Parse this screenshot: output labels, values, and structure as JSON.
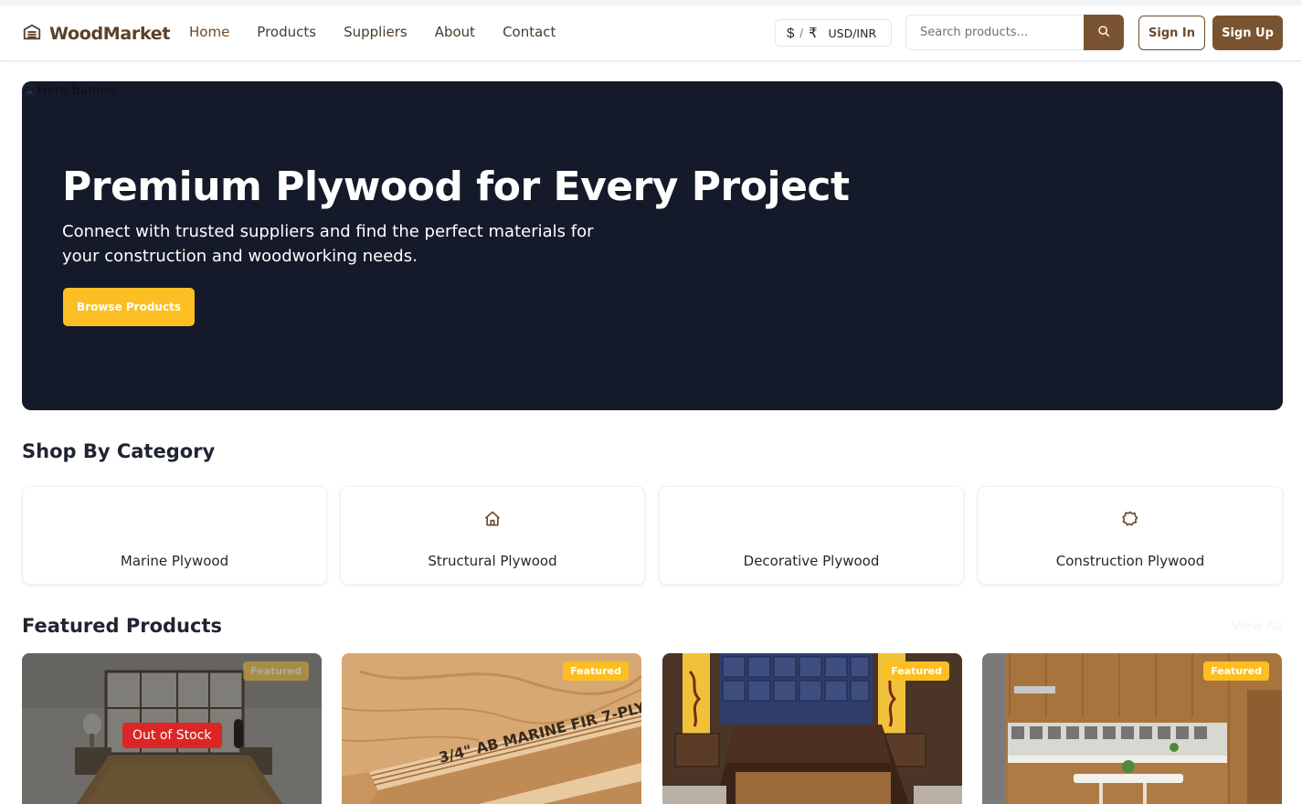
{
  "brand": {
    "name": "WoodMarket",
    "logo_icon": "warehouse-icon"
  },
  "nav": {
    "items": [
      "Home",
      "Products",
      "Suppliers",
      "About",
      "Contact"
    ]
  },
  "currency": {
    "dollar_symbol": "$",
    "separator": "/",
    "rupee_symbol": "₹",
    "code": "USD/INR"
  },
  "search": {
    "placeholder": "Search products...",
    "icon": "search-icon"
  },
  "auth": {
    "sign_in": "Sign In",
    "sign_up": "Sign Up"
  },
  "colors": {
    "brand": "#7a5430",
    "accent": "#fbbf24",
    "hero_bg": "#141a2a",
    "danger": "#dc2626"
  },
  "hero": {
    "image_alt": "Hero banner",
    "title": "Premium Plywood for Every Project",
    "subtitle": "Connect with trusted suppliers and find the perfect materials for your construction and woodworking needs.",
    "cta": "Browse Products"
  },
  "categories": {
    "title": "Shop By Category",
    "items": [
      {
        "label": "Marine Plywood",
        "icon": ""
      },
      {
        "label": "Structural Plywood",
        "icon": "home-icon"
      },
      {
        "label": "Decorative Plywood",
        "icon": ""
      },
      {
        "label": "Construction Plywood",
        "icon": "badge-icon"
      }
    ]
  },
  "featured": {
    "title": "Featured Products",
    "view_all": "View All",
    "products": [
      {
        "badge": "Featured",
        "status": "Out of Stock",
        "image": "bedroom-photo"
      },
      {
        "badge": "Featured",
        "status": "",
        "image": "plywood-sheets-photo",
        "stamp": "3/4\" AB MARINE FIR 7-PLY"
      },
      {
        "badge": "Featured",
        "status": "",
        "image": "bed-interior-photo"
      },
      {
        "badge": "Featured",
        "status": "",
        "image": "kitchen-photo"
      }
    ]
  }
}
